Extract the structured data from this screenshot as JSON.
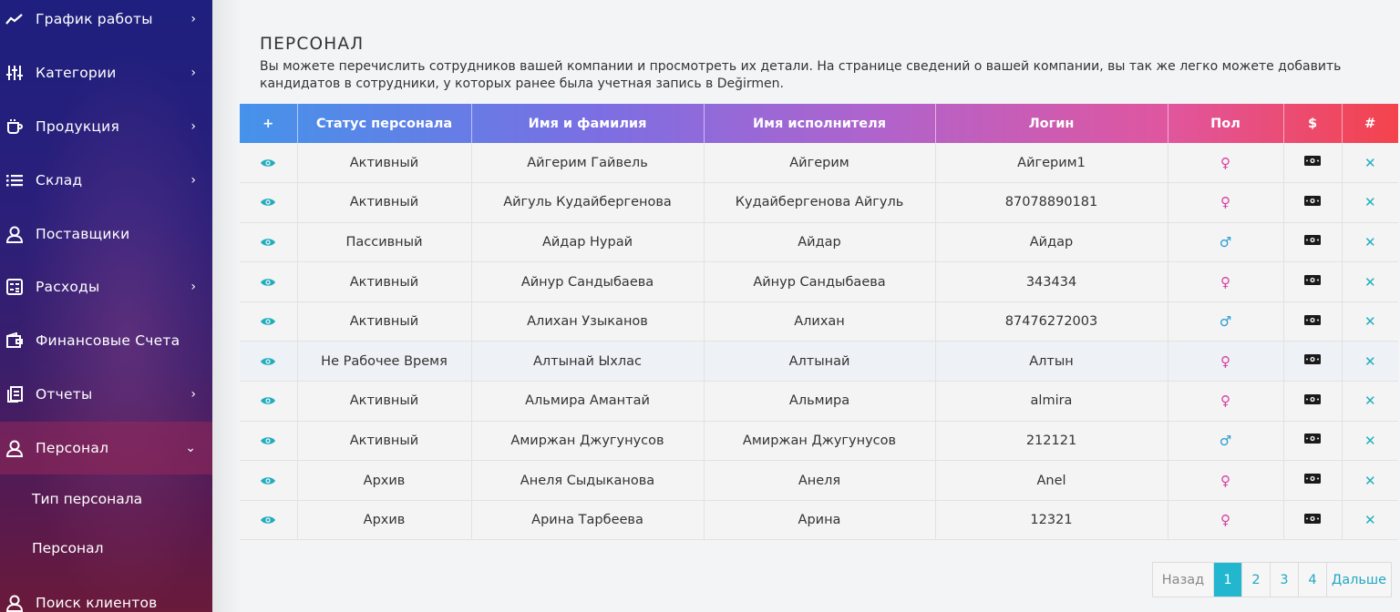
{
  "sidebar": {
    "items": [
      {
        "label": "График работы",
        "icon": "chart-line-icon",
        "chevron": "›"
      },
      {
        "label": "Категории",
        "icon": "sliders-icon",
        "chevron": "›"
      },
      {
        "label": "Продукция",
        "icon": "cup-icon",
        "chevron": "›"
      },
      {
        "label": "Склад",
        "icon": "list-icon",
        "chevron": "›"
      },
      {
        "label": "Поставщики",
        "icon": "user-icon",
        "chevron": ""
      },
      {
        "label": "Расходы",
        "icon": "calculator-icon",
        "chevron": "›"
      },
      {
        "label": "Финансовые Счета",
        "icon": "wallet-icon",
        "chevron": ""
      },
      {
        "label": "Отчеты",
        "icon": "document-icon",
        "chevron": "›"
      },
      {
        "label": "Персонал",
        "icon": "user-icon",
        "chevron": "⌄"
      }
    ],
    "subitems": [
      {
        "label": "Тип персонала"
      },
      {
        "label": "Персонал"
      }
    ],
    "last_item": {
      "label": "Поиск клиентов",
      "icon": "user-icon"
    }
  },
  "page": {
    "title": "ПЕРСОНАЛ",
    "description": "Вы можете перечислить сотрудников вашей компании и просмотреть их детали. На странице сведений о вашей компании, вы так же легко можете добавить кандидатов в сотрудники, у которых ранее была учетная запись в Değirmen."
  },
  "table": {
    "columns": [
      "+",
      "Статус персонала",
      "Имя и фамилия",
      "Имя исполнителя",
      "Логин",
      "Пол",
      "$",
      "#"
    ],
    "rows": [
      {
        "status": "Активный",
        "name": "Айгерим Гайвель",
        "performer": "Айгерим",
        "login": "Айгерим1",
        "gender": "♀",
        "action": "✕"
      },
      {
        "status": "Активный",
        "name": "Айгуль Кудайбергенова",
        "performer": "Кудайбергенова Айгуль",
        "login": "87078890181",
        "gender": "♀",
        "action": "✕"
      },
      {
        "status": "Пассивный",
        "name": "Айдар Нурай",
        "performer": "Айдар",
        "login": "Айдар",
        "gender": "♂",
        "action": "✕"
      },
      {
        "status": "Активный",
        "name": "Айнур Сандыбаева",
        "performer": "Айнур Сандыбаева",
        "login": "343434",
        "gender": "♀",
        "action": "✕"
      },
      {
        "status": "Активный",
        "name": "Алихан Узыканов",
        "performer": "Алихан",
        "login": "87476272003",
        "gender": "♂",
        "action": "✕"
      },
      {
        "status": "Не Рабочее Время",
        "name": "Алтынай Ыхлас",
        "performer": "Алтынай",
        "login": "Алтын",
        "gender": "♀",
        "action": "✕"
      },
      {
        "status": "Активный",
        "name": "Альмира Амантай",
        "performer": "Альмира",
        "login": "almira",
        "gender": "♀",
        "action": "✕"
      },
      {
        "status": "Активный",
        "name": "Амиржан Джугунусов",
        "performer": "Амиржан Джугунусов",
        "login": "212121",
        "gender": "♂",
        "action": "✕"
      },
      {
        "status": "Архив",
        "name": "Анеля Сыдыканова",
        "performer": "Анеля",
        "login": "Anel",
        "gender": "♀",
        "action": "✕"
      },
      {
        "status": "Архив",
        "name": "Арина Тарбеева",
        "performer": "Арина",
        "login": "12321",
        "gender": "♀",
        "action": "✕"
      }
    ]
  },
  "pagination": {
    "prev": "Назад",
    "pages": [
      "1",
      "2",
      "3",
      "4"
    ],
    "current": "1",
    "next": "Дальше"
  },
  "colors": {
    "accent": "#22b7cf",
    "female": "#d63da2",
    "male": "#2a9cd0"
  }
}
